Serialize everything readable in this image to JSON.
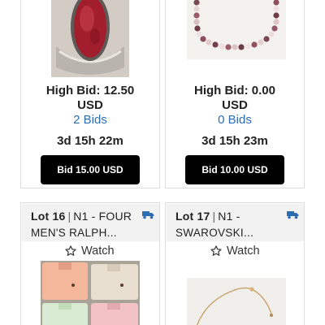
{
  "colors": {
    "accent": "#2c6db1",
    "button_bg": "#000000",
    "header_bg": "#f2f2f2"
  },
  "cards": [
    {
      "high_bid_line1": "High Bid: 12.50",
      "high_bid_line2": "USD",
      "bids": "2 Bids",
      "time_left": "3d 15h 22m",
      "button": "Bid 15.00 USD",
      "image": "ring-with-red-stone"
    },
    {
      "high_bid_line1": "High Bid: 0.00",
      "high_bid_line2": "USD",
      "bids": "0 Bids",
      "time_left": "3d 15h 23m",
      "button": "Bid 10.00 USD",
      "image": "pearl-necklace"
    },
    {
      "lot": "Lot 16",
      "title_line1": "N1 - FOUR",
      "title_line2": "MEN'S RALPH...",
      "watch": "Watch",
      "icon": "truck-icon",
      "image": "folded-polo-shirts"
    },
    {
      "lot": "Lot 17",
      "title_line1": "N1 -",
      "title_line2": "SWAROVSKI...",
      "watch": "Watch",
      "icon": "truck-icon",
      "image": "gold-chain-necklace"
    }
  ]
}
